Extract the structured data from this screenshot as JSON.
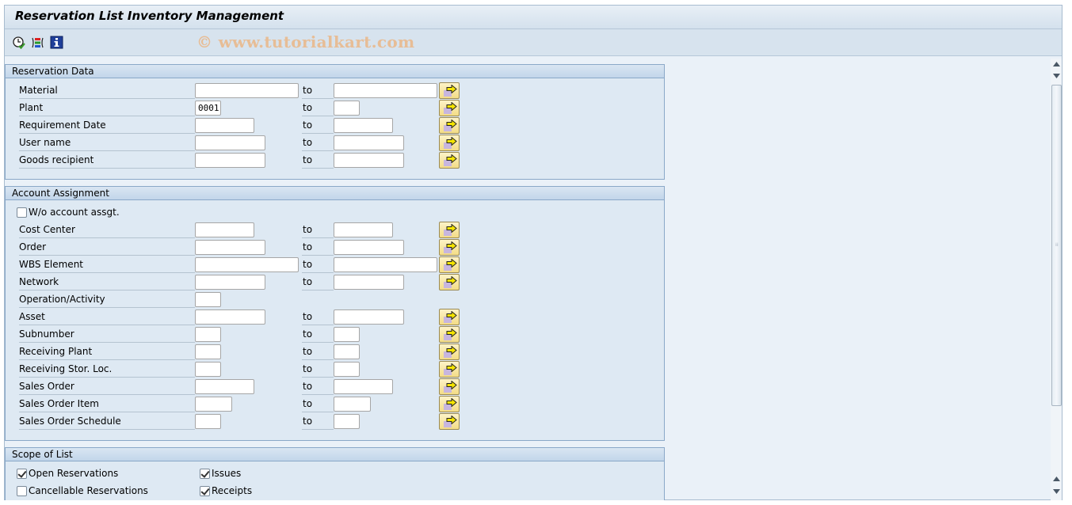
{
  "window": {
    "title": "Reservation List Inventory Management",
    "watermark": "© www.tutorialkart.com"
  },
  "toolbar": {
    "icons": [
      {
        "name": "execute-clock-icon",
        "tooltip": "Execute"
      },
      {
        "name": "selection-options-icon",
        "tooltip": "Selection options"
      },
      {
        "name": "info-icon",
        "tooltip": "Information"
      }
    ]
  },
  "groups": {
    "reservation_data": {
      "title": "Reservation Data",
      "to_label": "to",
      "rows": [
        {
          "label": "Material",
          "from": "",
          "to": ""
        },
        {
          "label": "Plant",
          "from": "0001",
          "to": ""
        },
        {
          "label": "Requirement Date",
          "from": "",
          "to": ""
        },
        {
          "label": "User name",
          "from": "",
          "to": ""
        },
        {
          "label": "Goods recipient",
          "from": "",
          "to": ""
        }
      ]
    },
    "account_assignment": {
      "title": "Account Assignment",
      "to_label": "to",
      "without_account_checkbox": {
        "label": "W/o account assgt.",
        "checked": false
      },
      "rows": [
        {
          "label": "Cost Center",
          "from": "",
          "to": ""
        },
        {
          "label": "Order",
          "from": "",
          "to": ""
        },
        {
          "label": "WBS Element",
          "from": "",
          "to": ""
        },
        {
          "label": "Network",
          "from": "",
          "to": ""
        },
        {
          "label": "Operation/Activity",
          "from": ""
        },
        {
          "label": "Asset",
          "from": "",
          "to": ""
        },
        {
          "label": "Subnumber",
          "from": "",
          "to": ""
        },
        {
          "label": "Receiving Plant",
          "from": "",
          "to": ""
        },
        {
          "label": "Receiving Stor. Loc.",
          "from": "",
          "to": ""
        },
        {
          "label": "Sales Order",
          "from": "",
          "to": ""
        },
        {
          "label": "Sales Order Item",
          "from": "",
          "to": ""
        },
        {
          "label": "Sales Order Schedule",
          "from": "",
          "to": ""
        }
      ]
    },
    "scope_of_list": {
      "title": "Scope of List",
      "checkboxes": [
        {
          "label": "Open Reservations",
          "checked": true
        },
        {
          "label": "Issues",
          "checked": true
        },
        {
          "label": "Cancellable Reservations",
          "checked": false
        },
        {
          "label": "Receipts",
          "checked": true
        }
      ]
    }
  }
}
